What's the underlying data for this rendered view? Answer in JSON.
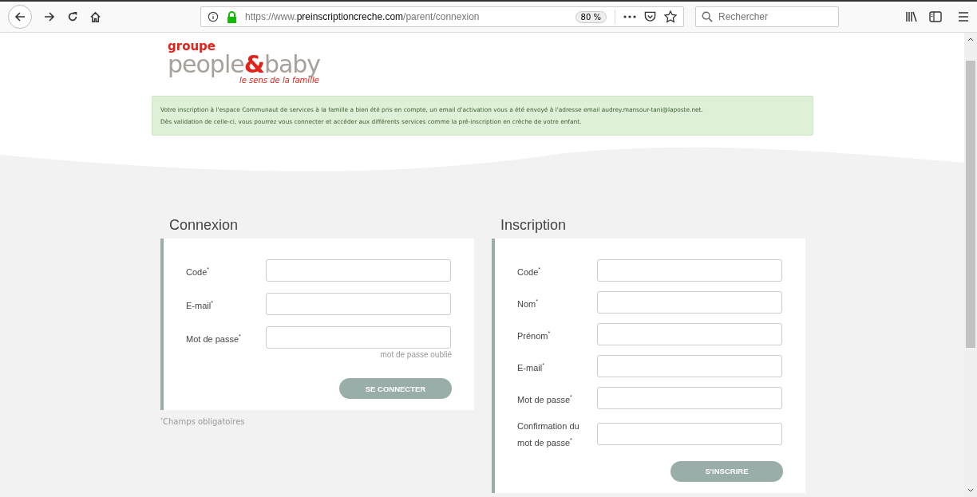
{
  "browser": {
    "url_prefix": "https://www.",
    "url_domain": "preinscriptioncreche.com",
    "url_path": "/parent/connexion",
    "zoom": "80 %",
    "search": {
      "placeholder": "Rechercher"
    }
  },
  "logo": {
    "top": "groupe",
    "name_left": "people",
    "ampersand": "&",
    "name_right": "baby",
    "tagline": "le sens de la famille"
  },
  "notice": {
    "lines": [
      "Votre inscription à l'espace Communaut de services à la famille a bien été pris en compte, un email d'activation vous a été envoyé à l'adresse email audrey.mansour-tani@laposte.net.",
      "Dès validation de celle-ci, vous pourrez vous connecter et accéder aux différents services comme la pré-inscription en crèche de votre enfant."
    ]
  },
  "login": {
    "title": "Connexion",
    "fields": [
      {
        "label": "Code$^{*}$"
      },
      {
        "label": "E-mail$^{*}$"
      },
      {
        "label": "Mot de passe$^{*}$"
      }
    ],
    "forgot_link": "mot de passe oublié",
    "button": "SE CONNECTER",
    "footnote": "$^{*}$Champs obligatoires"
  },
  "signup": {
    "title": "Inscription",
    "fields": [
      {
        "label": "Code$^{*}$"
      },
      {
        "label": "Nom$^{*}$"
      },
      {
        "label": "Prénom$^{*}$"
      },
      {
        "label": "E-mail$^{*}$"
      },
      {
        "label": "Mot de passe$^{*}$"
      },
      {
        "label": "Confirmation du mot de passe$^{*}$"
      }
    ],
    "button": "S'INSCRIRE"
  }
}
